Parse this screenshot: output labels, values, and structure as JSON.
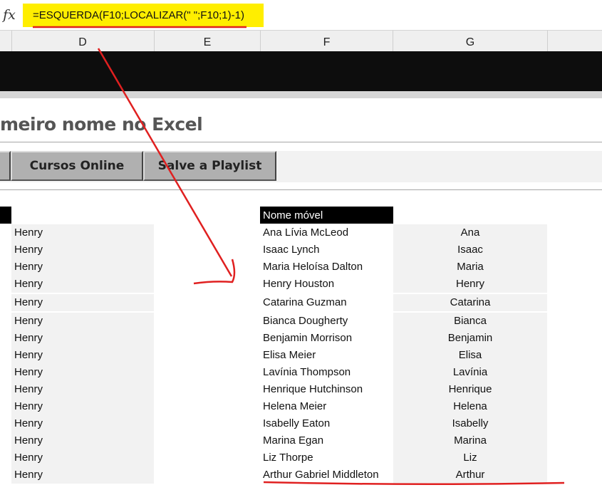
{
  "formula_bar": {
    "fx_label": "fx",
    "formula": "=ESQUERDA(F10;LOCALIZAR(\" \";F10;1)-1)"
  },
  "columns": [
    "D",
    "E",
    "F",
    "G"
  ],
  "title": "meiro nome no Excel",
  "buttons": [
    "Cursos Online",
    "Salve a Playlist"
  ],
  "table": {
    "header": "Nome móvel",
    "left_values": [
      "Henry",
      "Henry",
      "Henry",
      "Henry",
      "Henry",
      "Henry",
      "Henry",
      "Henry",
      "Henry",
      "Henry",
      "Henry",
      "Henry",
      "Henry",
      "Henry",
      "Henry"
    ],
    "full_names": [
      "Ana Lívia McLeod",
      "Isaac Lynch",
      "Maria Heloísa Dalton",
      "Henry Houston",
      "Catarina Guzman",
      "Bianca Dougherty",
      "Benjamin Morrison",
      "Elisa Meier",
      "Lavínia Thompson",
      "Henrique Hutchinson",
      "Helena Meier",
      "Isabelly Eaton",
      "Marina Egan",
      "Liz Thorpe",
      "Arthur Gabriel Middleton"
    ],
    "first_names": [
      "Ana",
      "Isaac",
      "Maria",
      "Henry",
      "Catarina",
      "Bianca",
      "Benjamin",
      "Elisa",
      "Lavínia",
      "Henrique",
      "Helena",
      "Isabelly",
      "Marina",
      "Liz",
      "Arthur"
    ]
  },
  "colors": {
    "highlight": "#ffee00",
    "annotation": "#e02020"
  }
}
